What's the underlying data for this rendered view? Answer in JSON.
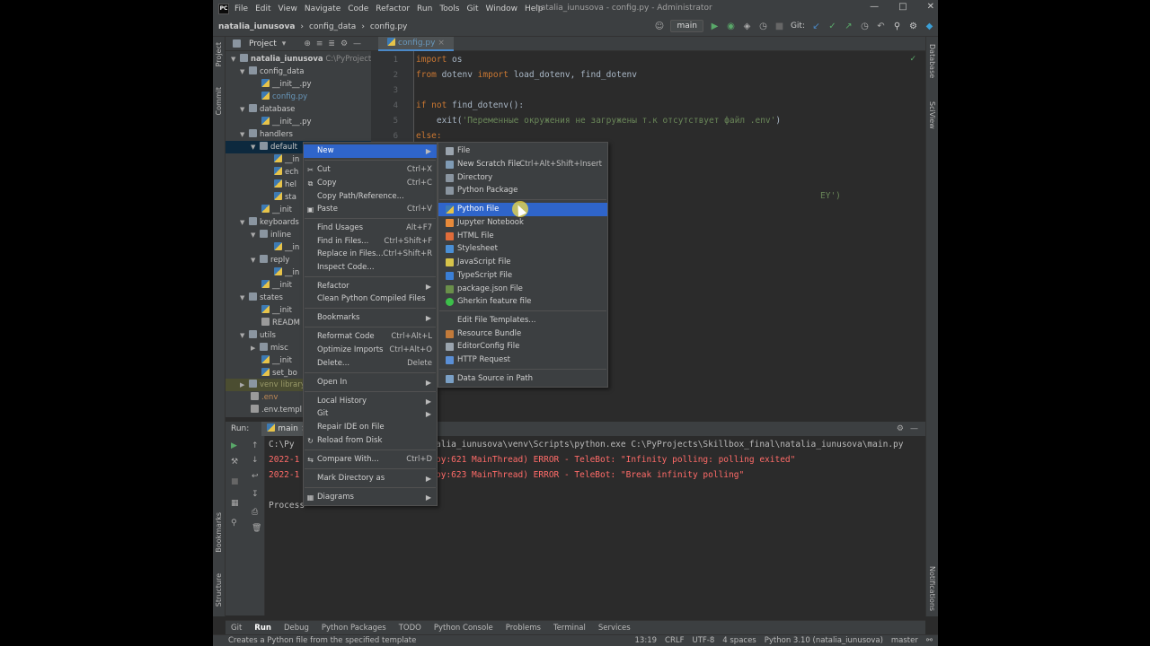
{
  "window": {
    "title": "natalia_iunusova - config.py - Administrator",
    "menu": [
      "File",
      "Edit",
      "View",
      "Navigate",
      "Code",
      "Refactor",
      "Run",
      "Tools",
      "Git",
      "Window",
      "Help"
    ]
  },
  "breadcrumb": [
    "natalia_iunusova",
    "config_data",
    "config.py"
  ],
  "toolbar": {
    "branch": "main",
    "git_label": "Git:"
  },
  "project_panel": {
    "title": "Project",
    "root": "natalia_iunusova",
    "root_path": "C:\\PyProjects\\Skil",
    "tree": [
      "config_data",
      "__init__.py",
      "config.py",
      "database",
      "__init__.py",
      "handlers",
      "default",
      "__in",
      "ech",
      "hel",
      "sta",
      "__init",
      "keyboards",
      "inline",
      "__in",
      "reply",
      "__in",
      "__init",
      "states",
      "__init",
      "READM",
      "utils",
      "misc",
      "__init",
      "set_bo",
      "venv library",
      ".env",
      ".env.templ"
    ]
  },
  "editor": {
    "tab": "config.py",
    "line_numbers": [
      "1",
      "2",
      "3",
      "4",
      "5",
      "6"
    ],
    "lines": {
      "l1_kw": "import",
      "l1_rest": " os",
      "l2_kw": "from",
      "l2_mid": " dotenv ",
      "l2_kw2": "import",
      "l2_rest": " load_dotenv, find_dotenv",
      "l4_kw": "if not",
      "l4_rest": " find_dotenv():",
      "l5_fn": "    exit(",
      "l5_str": "'Переменные окружения не загружены т.к отсутствует файл .env'",
      "l5_end": ")",
      "l6_kw": "else:",
      "frag": "EY')"
    }
  },
  "context_menu": {
    "items": [
      {
        "label": "New",
        "shortcut": "",
        "submenu": true
      },
      {
        "label": "Cut",
        "shortcut": "Ctrl+X"
      },
      {
        "label": "Copy",
        "shortcut": "Ctrl+C"
      },
      {
        "label": "Copy Path/Reference...",
        "shortcut": ""
      },
      {
        "label": "Paste",
        "shortcut": "Ctrl+V"
      },
      {
        "label": "Find Usages",
        "shortcut": "Alt+F7"
      },
      {
        "label": "Find in Files...",
        "shortcut": "Ctrl+Shift+F"
      },
      {
        "label": "Replace in Files...",
        "shortcut": "Ctrl+Shift+R"
      },
      {
        "label": "Inspect Code...",
        "shortcut": ""
      },
      {
        "label": "Refactor",
        "shortcut": ""
      },
      {
        "label": "Clean Python Compiled Files",
        "shortcut": ""
      },
      {
        "label": "Bookmarks",
        "shortcut": ""
      },
      {
        "label": "Reformat Code",
        "shortcut": "Ctrl+Alt+L"
      },
      {
        "label": "Optimize Imports",
        "shortcut": "Ctrl+Alt+O"
      },
      {
        "label": "Delete...",
        "shortcut": "Delete"
      },
      {
        "label": "Open In",
        "shortcut": ""
      },
      {
        "label": "Local History",
        "shortcut": ""
      },
      {
        "label": "Git",
        "shortcut": ""
      },
      {
        "label": "Repair IDE on File",
        "shortcut": ""
      },
      {
        "label": "Reload from Disk",
        "shortcut": ""
      },
      {
        "label": "Compare With...",
        "shortcut": "Ctrl+D"
      },
      {
        "label": "Mark Directory as",
        "shortcut": ""
      },
      {
        "label": "Diagrams",
        "shortcut": ""
      }
    ]
  },
  "new_submenu": {
    "items": [
      {
        "label": "File",
        "shortcut": ""
      },
      {
        "label": "New Scratch File",
        "shortcut": "Ctrl+Alt+Shift+Insert"
      },
      {
        "label": "Directory",
        "shortcut": ""
      },
      {
        "label": "Python Package",
        "shortcut": ""
      },
      {
        "label": "Python File",
        "shortcut": ""
      },
      {
        "label": "Jupyter Notebook",
        "shortcut": ""
      },
      {
        "label": "HTML File",
        "shortcut": ""
      },
      {
        "label": "Stylesheet",
        "shortcut": ""
      },
      {
        "label": "JavaScript File",
        "shortcut": ""
      },
      {
        "label": "TypeScript File",
        "shortcut": ""
      },
      {
        "label": "package.json File",
        "shortcut": ""
      },
      {
        "label": "Gherkin feature file",
        "shortcut": ""
      },
      {
        "label": "Edit File Templates...",
        "shortcut": ""
      },
      {
        "label": "Resource Bundle",
        "shortcut": ""
      },
      {
        "label": "EditorConfig File",
        "shortcut": ""
      },
      {
        "label": "HTTP Request",
        "shortcut": ""
      },
      {
        "label": "Data Source in Path",
        "shortcut": ""
      }
    ]
  },
  "run_panel": {
    "label": "Run:",
    "tab": "main",
    "lines": [
      "C:\\Py",
      "alia_iunusova\\venv\\Scripts\\python.exe C:\\PyProjects\\Skillbox_final\\natalia_iunusova\\main.py",
      "2022-1",
      "py:621 MainThread) ERROR - TeleBot: \"Infinity polling: polling exited\"",
      "2022-1",
      "py:623 MainThread) ERROR - TeleBot: \"Break infinity polling\"",
      "Process"
    ]
  },
  "bottom_tabs": [
    "Git",
    "Run",
    "Debug",
    "Python Packages",
    "TODO",
    "Python Console",
    "Problems",
    "Terminal",
    "Services"
  ],
  "side_tabs": {
    "left": [
      "Project",
      "Commit",
      "Bookmarks",
      "Structure"
    ],
    "right": [
      "Database",
      "SciView",
      "Notifications"
    ]
  },
  "status": {
    "message": "Creates a Python file from the specified template",
    "position": "13:19",
    "line_sep": "CRLF",
    "encoding": "UTF-8",
    "indent": "4 spaces",
    "interpreter": "Python 3.10 (natalia_iunusova)",
    "branch": "master"
  },
  "colors": {
    "highlight": "#2f65ca",
    "keyword": "#cc7832",
    "string": "#6a8759",
    "error": "#ff6b68"
  }
}
